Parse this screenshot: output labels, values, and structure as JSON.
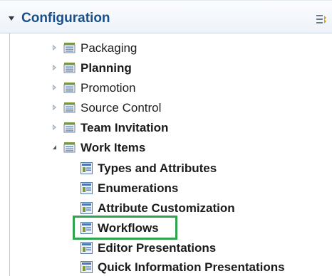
{
  "section": {
    "title": "Configuration"
  },
  "tree": {
    "items": [
      {
        "label": "Packaging"
      },
      {
        "label": "Planning"
      },
      {
        "label": "Promotion"
      },
      {
        "label": "Source Control"
      },
      {
        "label": "Team Invitation"
      },
      {
        "label": "Work Items"
      }
    ],
    "work_items_children": [
      {
        "label": "Types and Attributes"
      },
      {
        "label": "Enumerations"
      },
      {
        "label": "Attribute Customization"
      },
      {
        "label": "Workflows"
      },
      {
        "label": "Editor Presentations"
      },
      {
        "label": "Quick Information Presentations"
      }
    ]
  },
  "colors": {
    "section_title": "#19508a",
    "highlight_border": "#2ea44f",
    "header_bg": "#eef3f9"
  },
  "icons": {
    "section_toggle": "expanded-triangle-icon",
    "toolbar": "collapse-all-icon",
    "folder": "config-folder-icon",
    "page": "config-page-icon"
  }
}
